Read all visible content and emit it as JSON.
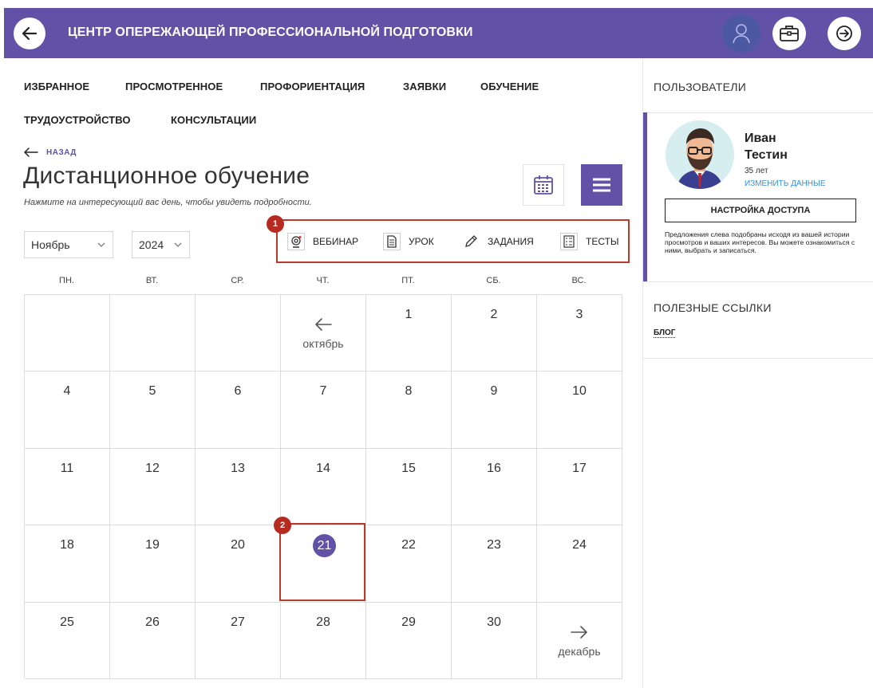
{
  "header": {
    "title": "ЦЕНТР ОПЕРЕЖАЮЩЕЙ ПРОФЕССИОНАЛЬНОЙ ПОДГОТОВКИ",
    "icons": [
      "arrow-left-icon",
      "user-icon",
      "briefcase-icon",
      "exit-icon"
    ]
  },
  "nav": {
    "items": [
      "ИЗБРАННОЕ",
      "ПРОСМОТРЕННОЕ",
      "ПРОФОРИЕНТАЦИЯ",
      "ЗАЯВКИ",
      "ОБУЧЕНИЕ",
      "ТРУДОУСТРОЙСТВО",
      "КОНСУЛЬТАЦИИ"
    ]
  },
  "page": {
    "back_label": "НАЗАД",
    "title": "Дистанционное обучение",
    "subtitle": "Нажмите на интересующий вас день, чтобы увидеть подробности."
  },
  "filters": {
    "month": "Ноябрь",
    "year": "2024"
  },
  "legend": {
    "items": [
      "ВЕБИНАР",
      "УРОК",
      "ЗАДАНИЯ",
      "ТЕСТЫ"
    ]
  },
  "markers": [
    "1",
    "2"
  ],
  "calendar": {
    "weekdays": [
      "ПН.",
      "ВТ.",
      "СР.",
      "ЧТ.",
      "ПТ.",
      "СБ.",
      "ВС."
    ],
    "prev_month": "октябрь",
    "next_month": "декабрь",
    "today": "21",
    "rows": [
      [
        "",
        "",
        "",
        "<",
        "1",
        "2",
        "3"
      ],
      [
        "4",
        "5",
        "6",
        "7",
        "8",
        "9",
        "10"
      ],
      [
        "11",
        "12",
        "13",
        "14",
        "15",
        "16",
        "17"
      ],
      [
        "18",
        "19",
        "20",
        "21",
        "22",
        "23",
        "24"
      ],
      [
        "25",
        "26",
        "27",
        "28",
        "29",
        "30",
        ">"
      ]
    ]
  },
  "sidebar": {
    "users_title": "ПОЛЬЗОВАТЕЛИ",
    "user_first_name": "Иван",
    "user_last_name": "Тестин",
    "user_age": "35 лет",
    "edit_link": "ИЗМЕНИТЬ ДАННЫЕ",
    "access_button": "НАСТРОЙКА ДОСТУПА",
    "hint": "Предложения слева подобраны исходя из вашей истории просмотров и ваших интересов. Вы можете ознакомиться с ними, выбрать и записаться.",
    "links_title": "ПОЛЕЗНЫЕ ССЫЛКИ",
    "blog_link": "БЛОГ"
  },
  "colors": {
    "brand": "#6152a8",
    "annotation": "#b83a2b",
    "link": "#3a8fd9"
  }
}
